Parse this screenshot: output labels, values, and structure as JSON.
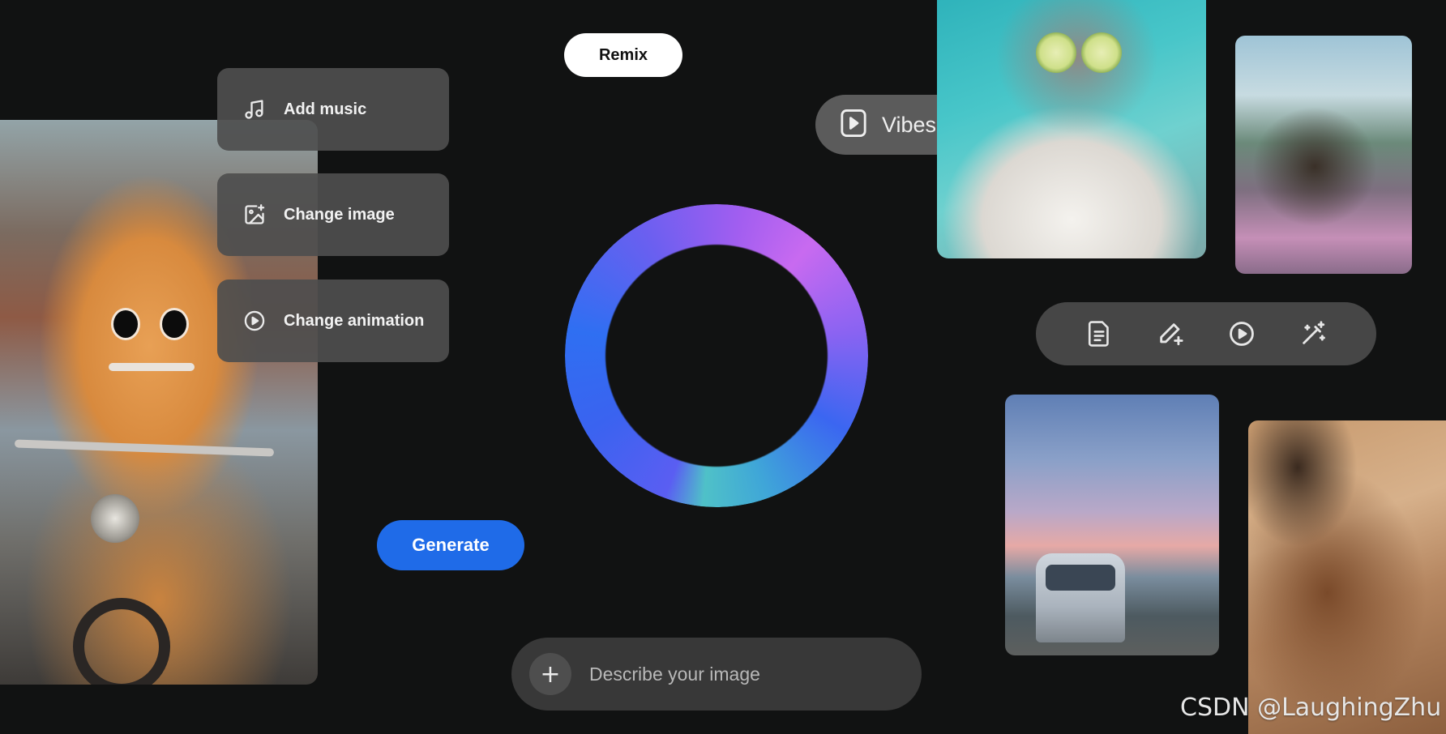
{
  "menu": {
    "items": [
      {
        "label": "Add music",
        "icon": "music-note-icon"
      },
      {
        "label": "Change image",
        "icon": "image-sparkle-icon"
      },
      {
        "label": "Change animation",
        "icon": "play-circle-icon"
      }
    ]
  },
  "remix": {
    "label": "Remix"
  },
  "vibes": {
    "label": "Vibes",
    "icon": "play-square-icon"
  },
  "toolbar": {
    "items": [
      {
        "icon": "document-icon"
      },
      {
        "icon": "pencil-sparkle-icon"
      },
      {
        "icon": "play-circle-icon"
      },
      {
        "icon": "magic-wand-icon"
      }
    ]
  },
  "generate": {
    "label": "Generate"
  },
  "prompt": {
    "placeholder": "Describe your image",
    "plus_icon": "plus-icon"
  },
  "watermark": {
    "text": "CSDN @LaughingZhu"
  },
  "colors": {
    "background": "#111212",
    "accent_blue": "#1f6be8",
    "ring_blue": "#2f6ff2",
    "ring_purple": "#c86af0",
    "ring_teal": "#4fc1c8",
    "card_gray": "#4e4e4e"
  }
}
